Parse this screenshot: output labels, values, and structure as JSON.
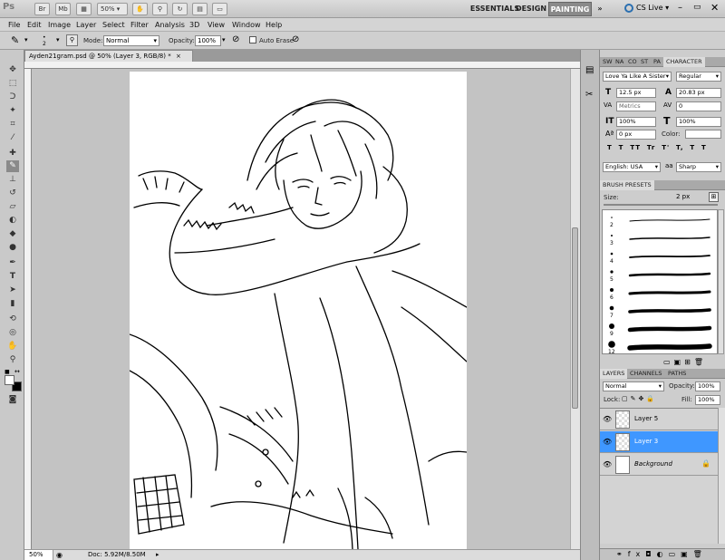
{
  "titlebar": {
    "app_logo": "Ps",
    "br_button": "Br",
    "mb_button": "Mb",
    "zoom": "50%",
    "workspaces": [
      "ESSENTIALS",
      "DESIGN",
      "PAINTING"
    ],
    "active_workspace": "PAINTING",
    "more": "»",
    "cs_live": "CS Live"
  },
  "menu": [
    "File",
    "Edit",
    "Image",
    "Layer",
    "Select",
    "Filter",
    "Analysis",
    "3D",
    "View",
    "Window",
    "Help"
  ],
  "options": {
    "brush_size": "2",
    "mode_label": "Mode:",
    "mode_value": "Normal",
    "opacity_label": "Opacity:",
    "opacity_value": "100%",
    "auto_erase_label": "Auto Erase"
  },
  "document": {
    "tab_title": "Ayden21gram.psd @ 50% (Layer 3, RGB/8) *",
    "status_zoom": "50%",
    "status_doc": "Doc: 5.92M/8.50M"
  },
  "character_panel": {
    "tabs": [
      "SW",
      "NA",
      "CO",
      "ST",
      "PA",
      "CHARACTER"
    ],
    "font_family": "Love Ya Like A Sister",
    "font_style": "Regular",
    "font_size": "12.5 px",
    "leading": "20.83 px",
    "kerning": "Metrics",
    "tracking": "0",
    "vertical_scale": "100%",
    "horizontal_scale": "100%",
    "baseline_shift": "0 px",
    "color_label": "Color:",
    "style_buttons": [
      "T",
      "T",
      "TT",
      "Tr",
      "T'",
      "T,",
      "T",
      "T"
    ],
    "language": "English: USA",
    "antialias_prefix": "aa",
    "antialias": "Sharp"
  },
  "brush_presets": {
    "title": "BRUSH PRESETS",
    "size_label": "Size:",
    "size_value": "2 px",
    "items": [
      {
        "size": "2"
      },
      {
        "size": "3"
      },
      {
        "size": "4"
      },
      {
        "size": "5"
      },
      {
        "size": "6"
      },
      {
        "size": "7"
      },
      {
        "size": "9"
      },
      {
        "size": "12"
      }
    ]
  },
  "layers_panel": {
    "tabs": [
      "LAYERS",
      "CHANNELS",
      "PATHS"
    ],
    "blend_mode": "Normal",
    "opacity_label": "Opacity:",
    "opacity_value": "100%",
    "lock_label": "Lock:",
    "fill_label": "Fill:",
    "fill_value": "100%",
    "layers": [
      {
        "name": "Layer 5",
        "selected": false
      },
      {
        "name": "Layer 3",
        "selected": true
      },
      {
        "name": "Background",
        "selected": false
      }
    ]
  },
  "colors": {
    "selected_layer": "#3f97ff",
    "active_workspace_bg": "#8a8a8a"
  }
}
